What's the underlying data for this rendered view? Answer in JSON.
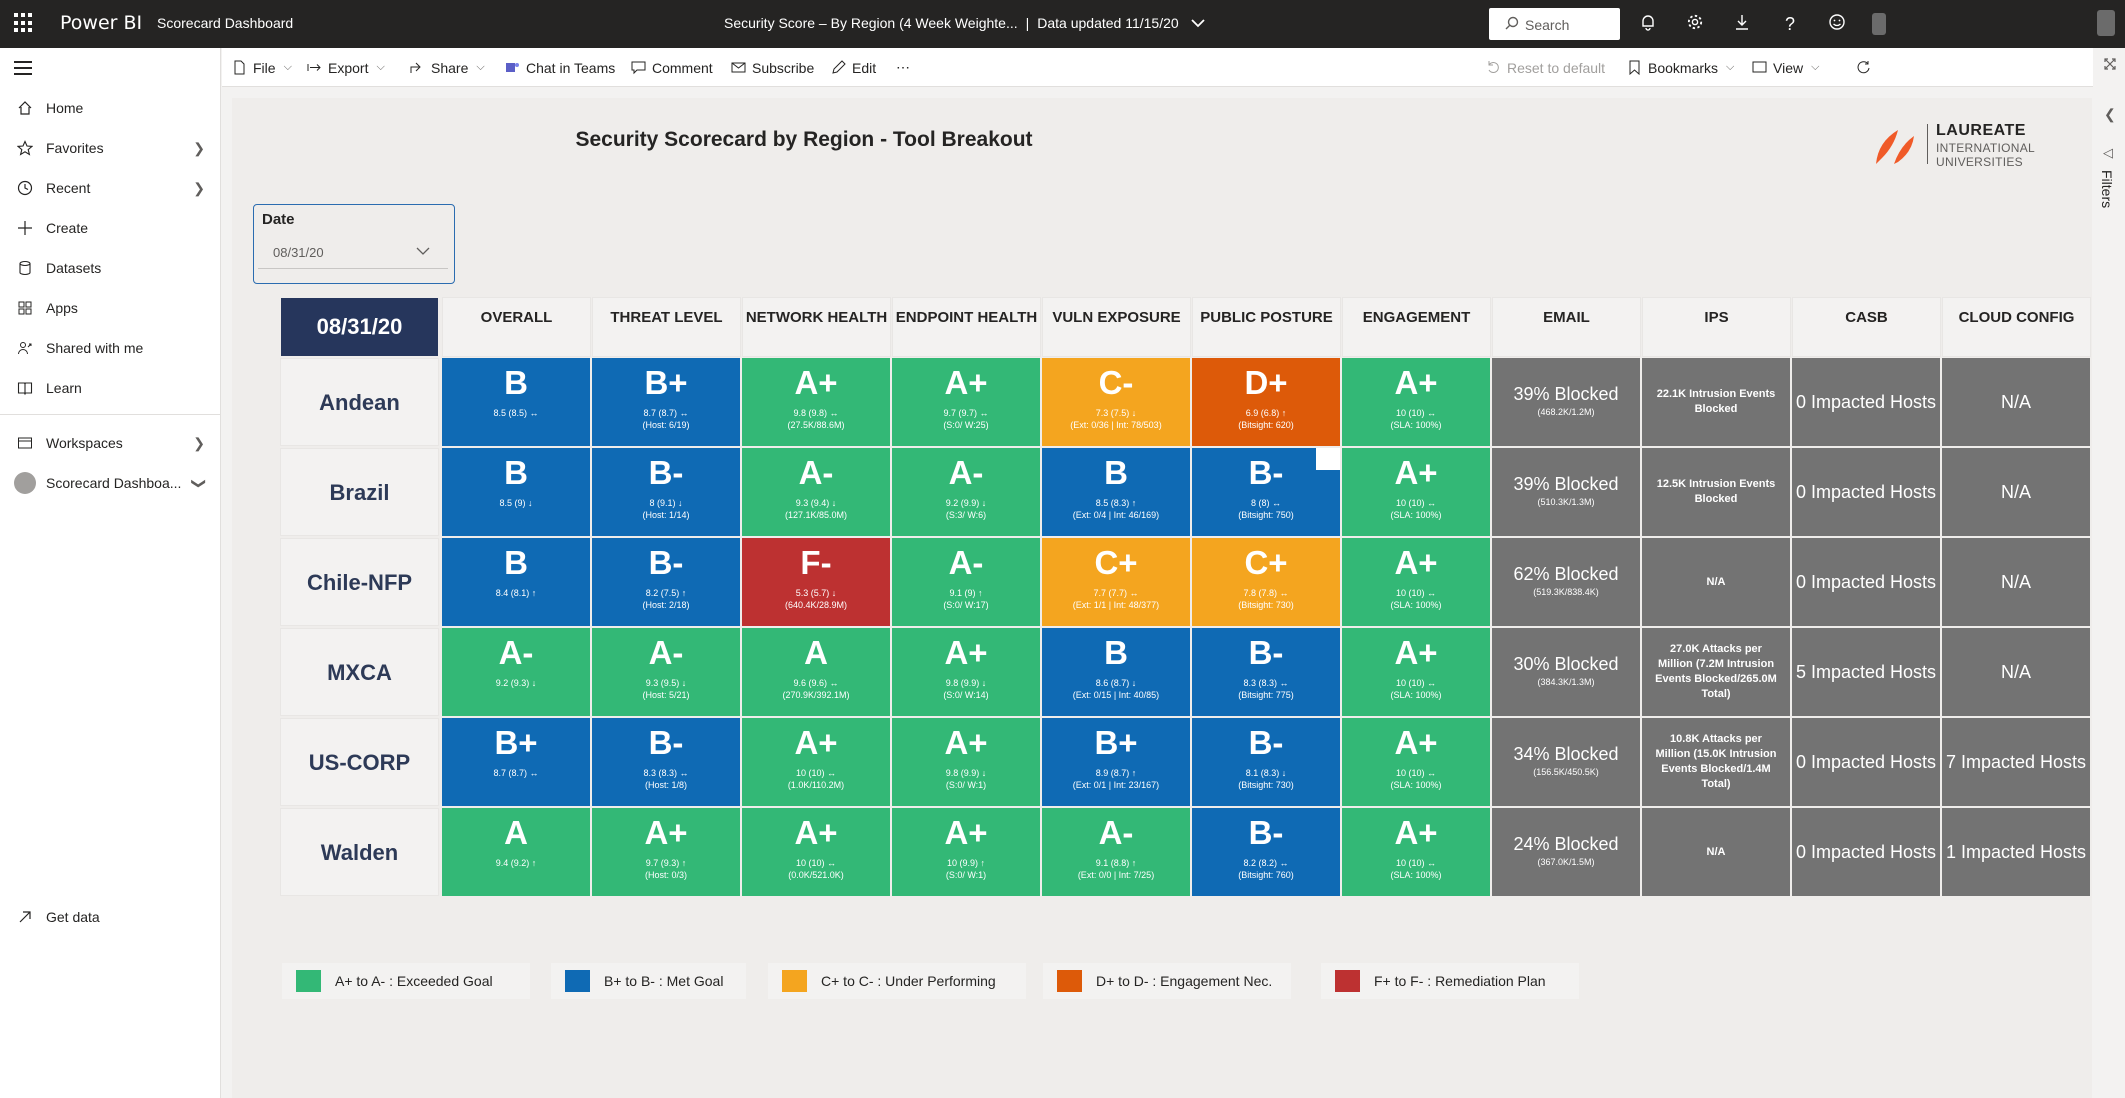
{
  "app": {
    "brand": "Power BI",
    "workspace": "Scorecard Dashboard"
  },
  "header": {
    "report_title": "Security Score – By Region (4 Week Weighte...",
    "separator": "|",
    "data_updated": "Data updated 11/15/20",
    "search_placeholder": "Search"
  },
  "sidebar": {
    "items": [
      {
        "label": "Home",
        "icon": "home-icon"
      },
      {
        "label": "Favorites",
        "icon": "star-icon"
      },
      {
        "label": "Recent",
        "icon": "clock-icon"
      },
      {
        "label": "Create",
        "icon": "plus-icon"
      },
      {
        "label": "Datasets",
        "icon": "database-icon"
      },
      {
        "label": "Apps",
        "icon": "apps-icon"
      },
      {
        "label": "Shared with me",
        "icon": "people-icon"
      },
      {
        "label": "Learn",
        "icon": "book-icon"
      },
      {
        "label": "Workspaces",
        "icon": "workspaces-icon"
      },
      {
        "label": "Scorecard Dashboa...",
        "icon": "workspace-avatar"
      },
      {
        "label": "Get data",
        "icon": "arrow-upright-icon"
      }
    ]
  },
  "toolbar": {
    "file": "File",
    "export": "Export",
    "share": "Share",
    "chat": "Chat in Teams",
    "comment": "Comment",
    "subscribe": "Subscribe",
    "edit": "Edit",
    "more": "⋯",
    "reset": "Reset to default",
    "bookmarks": "Bookmarks",
    "view": "View"
  },
  "report": {
    "title": "Security Scorecard by Region - Tool Breakout",
    "logo": {
      "line1": "LAUREATE",
      "line2": "INTERNATIONAL",
      "line3": "UNIVERSITIES"
    },
    "slicer": {
      "label": "Date",
      "value": "08/31/20"
    },
    "date_header": "08/31/20",
    "columns": [
      "OVERALL",
      "THREAT LEVEL",
      "NETWORK HEALTH",
      "ENDPOINT HEALTH",
      "VULN EXPOSURE",
      "PUBLIC POSTURE",
      "ENGAGEMENT",
      "EMAIL",
      "IPS",
      "CASB",
      "CLOUD CONFIG"
    ],
    "colors": {
      "green": "#33b876",
      "blue": "#0f6ab4",
      "amber": "#f4a51f",
      "orange": "#dd5a09",
      "red": "#bd3131",
      "gray": "#737373",
      "navy": "#26365c"
    },
    "rows": [
      {
        "region": "Andean",
        "scores": [
          {
            "grade": "B",
            "line1": "8.5 (8.5) ↔",
            "line2": "",
            "color": "blue"
          },
          {
            "grade": "B+",
            "line1": "8.7 (8.7) ↔",
            "line2": "(Host: 6/19)",
            "color": "blue"
          },
          {
            "grade": "A+",
            "line1": "9.8 (9.8) ↔",
            "line2": "(27.5K/88.6M)",
            "color": "green"
          },
          {
            "grade": "A+",
            "line1": "9.7 (9.7) ↔",
            "line2": "(S:0/ W:25)",
            "color": "green"
          },
          {
            "grade": "C-",
            "line1": "7.3 (7.5) ↓",
            "line2": "(Ext: 0/36 | Int: 78/503)",
            "color": "amber"
          },
          {
            "grade": "D+",
            "line1": "6.9 (6.8) ↑",
            "line2": "(Bitsight: 620)",
            "color": "orange"
          },
          {
            "grade": "A+",
            "line1": "10 (10) ↔",
            "line2": "(SLA: 100%)",
            "color": "green"
          }
        ],
        "email": {
          "main": "39% Blocked",
          "sub": "(468.2K/1.2M)"
        },
        "ips": "22.1K Intrusion Events Blocked",
        "casb": "0 Impacted Hosts",
        "cloud": "N/A"
      },
      {
        "region": "Brazil",
        "scores": [
          {
            "grade": "B",
            "line1": "8.5 (9) ↓",
            "line2": "",
            "color": "blue"
          },
          {
            "grade": "B-",
            "line1": "8 (9.1) ↓",
            "line2": "(Host: 1/14)",
            "color": "blue"
          },
          {
            "grade": "A-",
            "line1": "9.3 (9.4) ↓",
            "line2": "(127.1K/85.0M)",
            "color": "green"
          },
          {
            "grade": "A-",
            "line1": "9.2 (9.9) ↓",
            "line2": "(S:3/ W:6)",
            "color": "green"
          },
          {
            "grade": "B",
            "line1": "8.5 (8.3) ↑",
            "line2": "(Ext: 0/4 | Int: 46/169)",
            "color": "blue"
          },
          {
            "grade": "B-",
            "line1": "8 (8) ↔",
            "line2": "(Bitsight: 750)",
            "color": "blue"
          },
          {
            "grade": "A+",
            "line1": "10 (10) ↔",
            "line2": "(SLA: 100%)",
            "color": "green"
          }
        ],
        "email": {
          "main": "39% Blocked",
          "sub": "(510.3K/1.3M)"
        },
        "ips": "12.5K Intrusion Events Blocked",
        "casb": "0 Impacted Hosts",
        "cloud": "N/A"
      },
      {
        "region": "Chile-NFP",
        "scores": [
          {
            "grade": "B",
            "line1": "8.4 (8.1) ↑",
            "line2": "",
            "color": "blue"
          },
          {
            "grade": "B-",
            "line1": "8.2 (7.5) ↑",
            "line2": "(Host: 2/18)",
            "color": "blue"
          },
          {
            "grade": "F-",
            "line1": "5.3 (5.7) ↓",
            "line2": "(640.4K/28.9M)",
            "color": "red"
          },
          {
            "grade": "A-",
            "line1": "9.1 (9) ↑",
            "line2": "(S:0/ W:17)",
            "color": "green"
          },
          {
            "grade": "C+",
            "line1": "7.7 (7.7) ↔",
            "line2": "(Ext: 1/1 | Int: 48/377)",
            "color": "amber"
          },
          {
            "grade": "C+",
            "line1": "7.8 (7.8) ↔",
            "line2": "(Bitsight: 730)",
            "color": "amber"
          },
          {
            "grade": "A+",
            "line1": "10 (10) ↔",
            "line2": "(SLA: 100%)",
            "color": "green"
          }
        ],
        "email": {
          "main": "62% Blocked",
          "sub": "(519.3K/838.4K)"
        },
        "ips": "N/A",
        "casb": "0 Impacted Hosts",
        "cloud": "N/A"
      },
      {
        "region": "MXCA",
        "scores": [
          {
            "grade": "A-",
            "line1": "9.2 (9.3) ↓",
            "line2": "",
            "color": "green"
          },
          {
            "grade": "A-",
            "line1": "9.3 (9.5) ↓",
            "line2": "(Host: 5/21)",
            "color": "green"
          },
          {
            "grade": "A",
            "line1": "9.6 (9.6) ↔",
            "line2": "(270.9K/392.1M)",
            "color": "green"
          },
          {
            "grade": "A+",
            "line1": "9.8 (9.9) ↓",
            "line2": "(S:0/ W:14)",
            "color": "green"
          },
          {
            "grade": "B",
            "line1": "8.6 (8.7) ↓",
            "line2": "(Ext: 0/15 | Int: 40/85)",
            "color": "blue"
          },
          {
            "grade": "B-",
            "line1": "8.3 (8.3) ↔",
            "line2": "(Bitsight: 775)",
            "color": "blue"
          },
          {
            "grade": "A+",
            "line1": "10 (10) ↔",
            "line2": "(SLA: 100%)",
            "color": "green"
          }
        ],
        "email": {
          "main": "30% Blocked",
          "sub": "(384.3K/1.3M)"
        },
        "ips": "27.0K Attacks per Million (7.2M Intrusion Events Blocked/265.0M Total)",
        "casb": "5 Impacted Hosts",
        "cloud": "N/A"
      },
      {
        "region": "US-CORP",
        "scores": [
          {
            "grade": "B+",
            "line1": "8.7 (8.7) ↔",
            "line2": "",
            "color": "blue"
          },
          {
            "grade": "B-",
            "line1": "8.3 (8.3) ↔",
            "line2": "(Host: 1/8)",
            "color": "blue"
          },
          {
            "grade": "A+",
            "line1": "10 (10) ↔",
            "line2": "(1.0K/110.2M)",
            "color": "green"
          },
          {
            "grade": "A+",
            "line1": "9.8 (9.9) ↓",
            "line2": "(S:0/ W:1)",
            "color": "green"
          },
          {
            "grade": "B+",
            "line1": "8.9 (8.7) ↑",
            "line2": "(Ext: 0/1 | Int: 23/167)",
            "color": "blue"
          },
          {
            "grade": "B-",
            "line1": "8.1 (8.3) ↓",
            "line2": "(Bitsight: 730)",
            "color": "blue"
          },
          {
            "grade": "A+",
            "line1": "10 (10) ↔",
            "line2": "(SLA: 100%)",
            "color": "green"
          }
        ],
        "email": {
          "main": "34% Blocked",
          "sub": "(156.5K/450.5K)"
        },
        "ips": "10.8K Attacks per Million (15.0K Intrusion Events Blocked/1.4M Total)",
        "casb": "0 Impacted Hosts",
        "cloud": "7 Impacted Hosts"
      },
      {
        "region": "Walden",
        "scores": [
          {
            "grade": "A",
            "line1": "9.4 (9.2) ↑",
            "line2": "",
            "color": "green"
          },
          {
            "grade": "A+",
            "line1": "9.7 (9.3) ↑",
            "line2": "(Host: 0/3)",
            "color": "green"
          },
          {
            "grade": "A+",
            "line1": "10 (10) ↔",
            "line2": "(0.0K/521.0K)",
            "color": "green"
          },
          {
            "grade": "A+",
            "line1": "10 (9.9) ↑",
            "line2": "(S:0/ W:1)",
            "color": "green"
          },
          {
            "grade": "A-",
            "line1": "9.1 (8.8) ↑",
            "line2": "(Ext: 0/0 | Int: 7/25)",
            "color": "green"
          },
          {
            "grade": "B-",
            "line1": "8.2 (8.2) ↔",
            "line2": "(Bitsight: 760)",
            "color": "blue"
          },
          {
            "grade": "A+",
            "line1": "10 (10) ↔",
            "line2": "(SLA: 100%)",
            "color": "green"
          }
        ],
        "email": {
          "main": "24% Blocked",
          "sub": "(367.0K/1.5M)"
        },
        "ips": "N/A",
        "casb": "0 Impacted Hosts",
        "cloud": "1 Impacted Hosts"
      }
    ],
    "legend": [
      {
        "label": "A+ to A- : Exceeded Goal",
        "color": "green"
      },
      {
        "label": "B+ to B- : Met Goal",
        "color": "blue"
      },
      {
        "label": "C+ to C- : Under Performing",
        "color": "amber"
      },
      {
        "label": "D+ to D- : Engagement Nec.",
        "color": "orange"
      },
      {
        "label": "F+ to F- : Remediation Plan",
        "color": "red"
      }
    ]
  },
  "filters_pane": {
    "label": "Filters"
  }
}
